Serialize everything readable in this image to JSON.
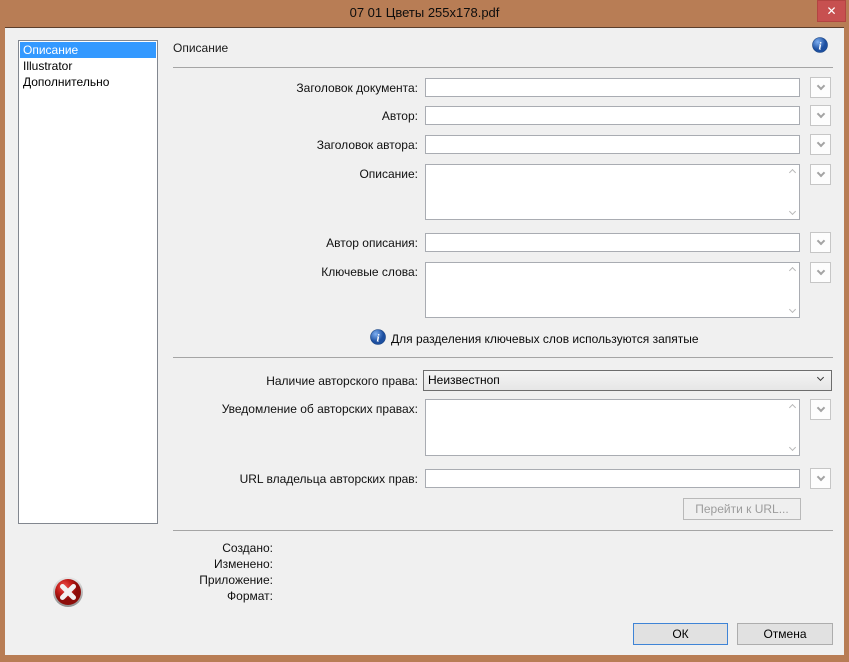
{
  "window": {
    "title": "07 01 Цветы 255x178.pdf",
    "close_glyph": "✕"
  },
  "sidebar": {
    "items": [
      {
        "label": "Описание"
      },
      {
        "label": "Illustrator"
      },
      {
        "label": "Дополнительно"
      }
    ],
    "selected_index": 0
  },
  "panel": {
    "header": "Описание",
    "rows": [
      {
        "label": "Заголовок документа:",
        "value": ""
      },
      {
        "label": "Автор:",
        "value": ""
      },
      {
        "label": "Заголовок автора:",
        "value": ""
      },
      {
        "label": "Описание:",
        "value": ""
      },
      {
        "label": "Автор описания:",
        "value": ""
      },
      {
        "label": "Ключевые слова:",
        "value": ""
      }
    ],
    "keywords_note": "Для разделения ключевых слов используются запятые",
    "copyright": {
      "status_label": "Наличие авторского права:",
      "status_value": "Неизвестноп",
      "notice_label": "Уведомление об авторских правах:",
      "notice_value": "",
      "url_label": "URL владельца авторских прав:",
      "url_value": "",
      "goto_url_button": "Перейти к URL..."
    },
    "meta": [
      {
        "label": "Создано:",
        "value": ""
      },
      {
        "label": "Изменено:",
        "value": ""
      },
      {
        "label": "Приложение:",
        "value": ""
      },
      {
        "label": "Формат:",
        "value": ""
      }
    ]
  },
  "footer": {
    "ok_label": "ОК",
    "cancel_label": "Отмена"
  },
  "colors": {
    "titlebar": "#b87d55",
    "close_button": "#c75050",
    "selection": "#3399ff",
    "info_blue": "#2a5fc0",
    "error_red": "#c11b17",
    "content_bg": "#f0f0f0"
  }
}
